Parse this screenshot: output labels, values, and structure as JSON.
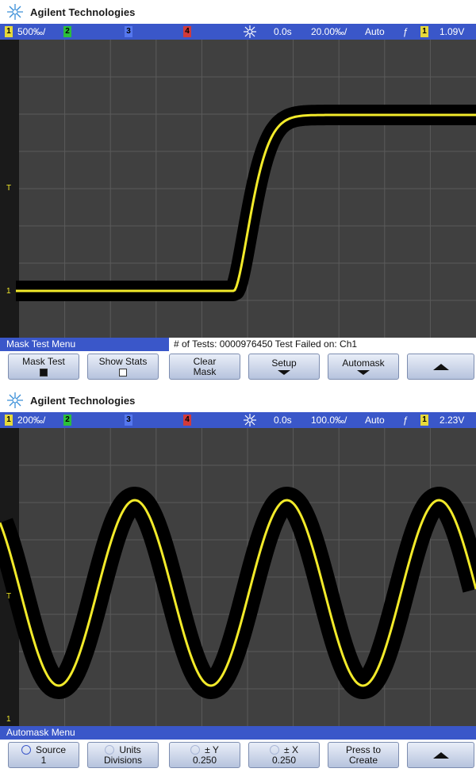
{
  "panels": [
    {
      "brand": "Agilent Technologies",
      "status": {
        "ch1_scale": "500‰/",
        "ch1": "1",
        "ch2": "2",
        "ch3": "3",
        "ch4": "4",
        "delay": "0.0s",
        "timebase": "20.00‰/",
        "trigger_mode": "Auto",
        "trigger_source": "1",
        "trigger_level": "1.09V"
      },
      "menu": {
        "title": "Mask Test Menu",
        "message": "# of Tests: 0000976450  Test Failed on: Ch1"
      },
      "softkeys": {
        "k1_line1": "Mask Test",
        "k2_line1": "Show Stats",
        "k3_line1": "Clear",
        "k3_line2": "Mask",
        "k4_line1": "Setup",
        "k5_line1": "Automask"
      },
      "mask_test_enabled": true,
      "show_stats_enabled": false
    },
    {
      "brand": "Agilent Technologies",
      "status": {
        "ch1_scale": "200‰/",
        "ch1": "1",
        "ch2": "2",
        "ch3": "3",
        "ch4": "4",
        "delay": "0.0s",
        "timebase": "100.0‰/",
        "trigger_mode": "Auto",
        "trigger_source": "1",
        "trigger_level": "2.23V"
      },
      "menu": {
        "title": "Automask Menu",
        "message": ""
      },
      "softkeys": {
        "k1_line1": "Source",
        "k1_line2": "1",
        "k2_line1": "Units",
        "k2_line2": "Divisions",
        "k3_line1": "± Y",
        "k3_line2": "0.250",
        "k4_line1": "± X",
        "k4_line2": "0.250",
        "k5_line1": "Press to",
        "k5_line2": "Create"
      }
    }
  ],
  "colors": {
    "accent": "#3a57c9",
    "trace": "#f2ea2a",
    "mask": "#000000",
    "screen": "#404040"
  }
}
